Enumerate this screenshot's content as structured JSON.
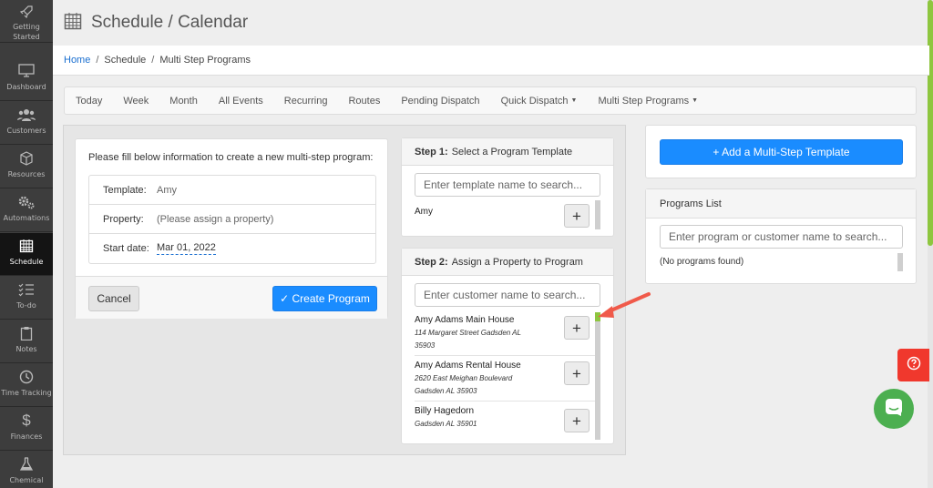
{
  "sidebar": {
    "items": [
      {
        "label": "Getting Started",
        "icon": "rocket-icon"
      },
      {
        "label": "Dashboard",
        "icon": "monitor-icon"
      },
      {
        "label": "Customers",
        "icon": "users-icon"
      },
      {
        "label": "Resources",
        "icon": "box-icon"
      },
      {
        "label": "Automations",
        "icon": "gears-icon"
      },
      {
        "label": "Schedule",
        "icon": "calendar-icon",
        "active": true
      },
      {
        "label": "To-do",
        "icon": "checklist-icon"
      },
      {
        "label": "Notes",
        "icon": "clipboard-icon"
      },
      {
        "label": "Time Tracking",
        "icon": "clock-icon"
      },
      {
        "label": "Finances",
        "icon": "dollar-icon"
      },
      {
        "label": "Chemical",
        "icon": "flask-icon"
      }
    ]
  },
  "header": {
    "title": "Schedule / Calendar",
    "icon": "calendar-icon"
  },
  "breadcrumb": {
    "home": "Home",
    "schedule": "Schedule",
    "current": "Multi Step Programs"
  },
  "nav": {
    "items": [
      {
        "label": "Today"
      },
      {
        "label": "Week"
      },
      {
        "label": "Month"
      },
      {
        "label": "All Events"
      },
      {
        "label": "Recurring"
      },
      {
        "label": "Routes"
      },
      {
        "label": "Pending Dispatch"
      },
      {
        "label": "Quick Dispatch",
        "caret": "▼"
      },
      {
        "label": "Multi Step Programs",
        "caret": "▼"
      }
    ]
  },
  "form": {
    "intro": "Please fill below information to create a new multi-step program:",
    "template_label": "Template:",
    "template_value": "Amy",
    "property_label": "Property:",
    "property_value": "(Please assign a property)",
    "start_label": "Start date:",
    "start_value": "Mar 01, 2022",
    "cancel": "Cancel",
    "create": "✓ Create Program"
  },
  "step1": {
    "num": "Step 1:",
    "title": "Select a Program Template",
    "placeholder": "Enter template name to search...",
    "items": [
      {
        "name": "Amy"
      }
    ]
  },
  "step2": {
    "num": "Step 2:",
    "title": "Assign a Property to Program",
    "placeholder": "Enter customer name to search...",
    "items": [
      {
        "name": "Amy Adams Main House",
        "address1": "114 Margaret Street Gadsden AL",
        "address2": "35903"
      },
      {
        "name": "Amy Adams Rental House",
        "address1": "2620 East Meighan Boulevard",
        "address2": "Gadsden AL 35903"
      },
      {
        "name": "Billy Hagedorn",
        "address1": "Gadsden AL 35901",
        "address2": ""
      }
    ]
  },
  "right": {
    "add_button": "+ Add a Multi-Step Template",
    "programs_title": "Programs List",
    "programs_placeholder": "Enter program or customer name to search...",
    "empty": "(No programs found)"
  },
  "plus": "+",
  "colors": {
    "primary": "#1a8cff",
    "accent": "#8ec63f",
    "arrow": "#f05a4a",
    "help": "#f0382d",
    "chat": "#4caf50",
    "sidebar": "#3d3d3d"
  }
}
